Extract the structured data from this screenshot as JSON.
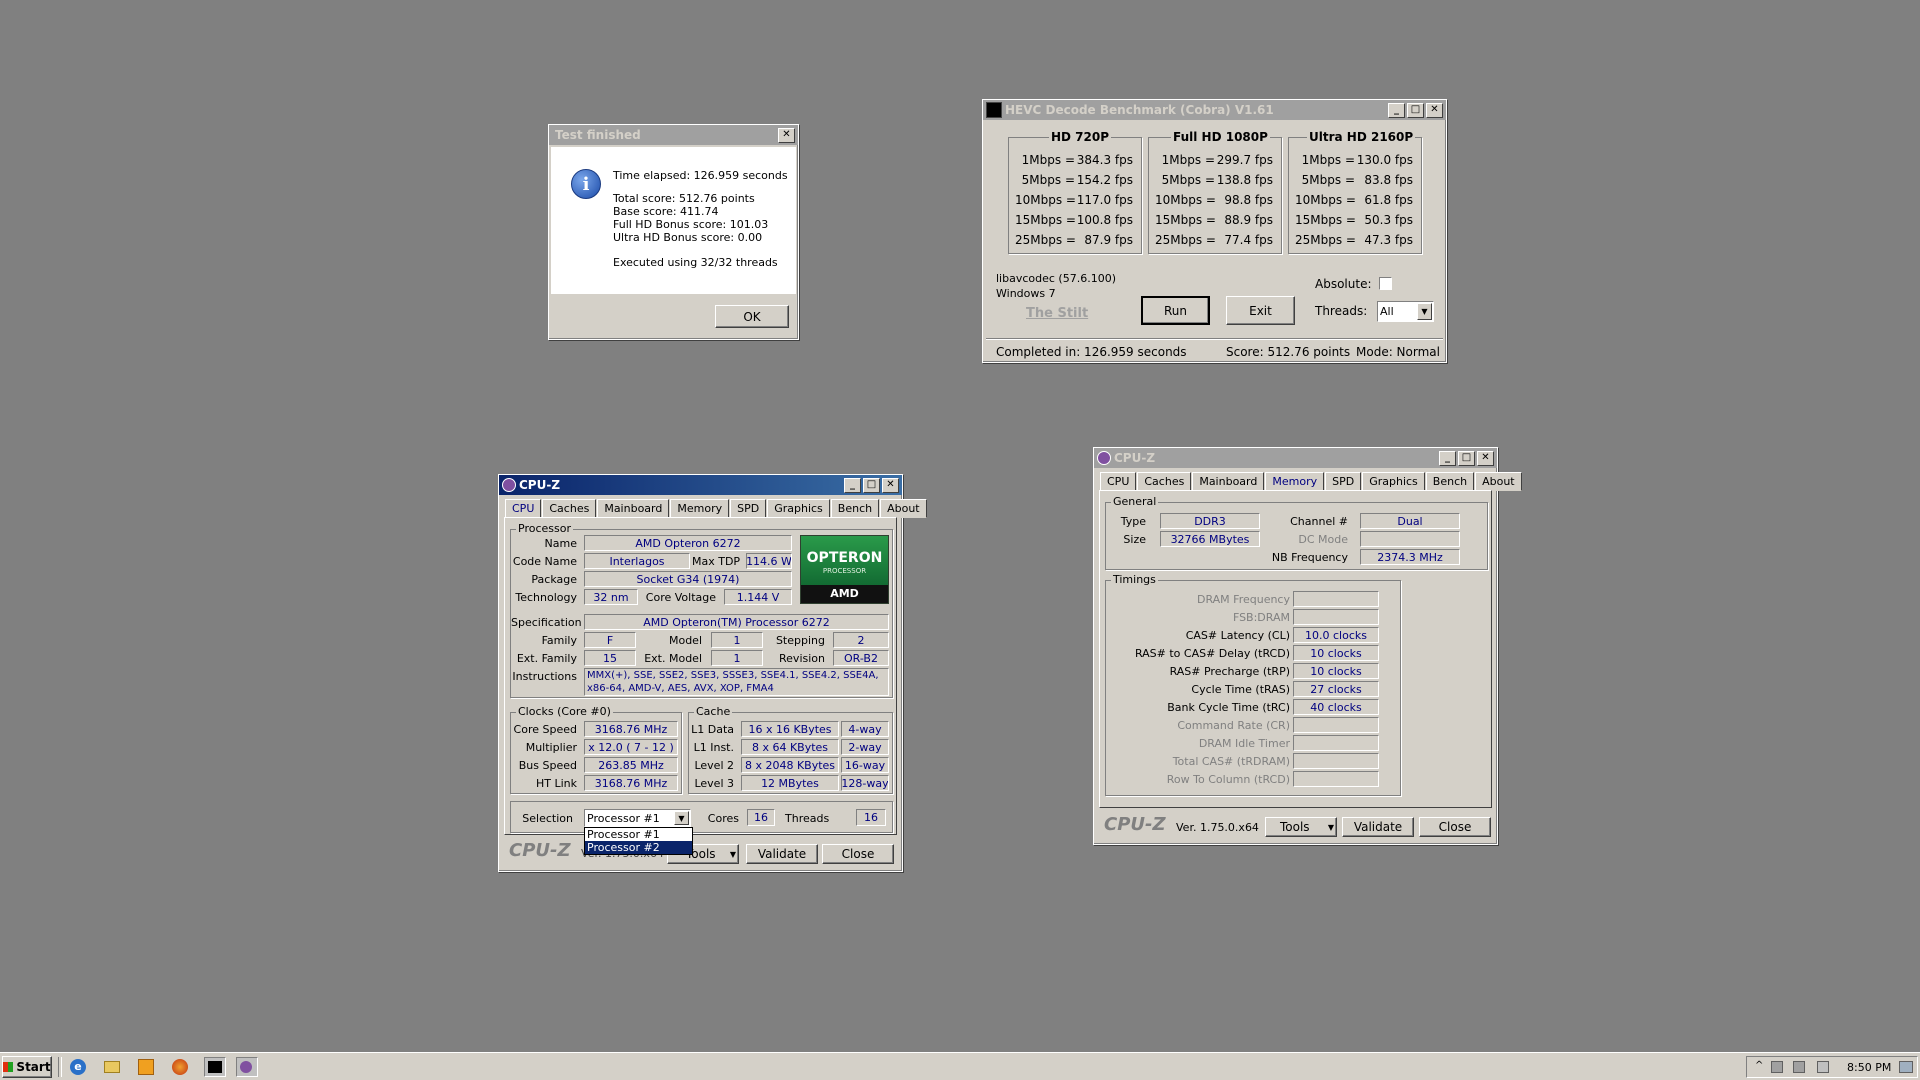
{
  "test_dialog": {
    "title": "Test finished",
    "elapsed": "Time elapsed:  126.959 seconds",
    "total": "Total score:  512.76 points",
    "base": "Base score: 411.74",
    "fullhd": "Full HD Bonus score: 101.03",
    "ultrahd": "Ultra HD Bonus score: 0.00",
    "threads": "Executed using 32/32 threads",
    "ok": "OK"
  },
  "hevc": {
    "title": "HEVC Decode Benchmark (Cobra) V1.61",
    "groups": [
      {
        "title": "HD 720P",
        "rows": [
          [
            "1Mbps =",
            "384.3 fps"
          ],
          [
            "5Mbps =",
            "154.2 fps"
          ],
          [
            "10Mbps =",
            "117.0 fps"
          ],
          [
            "15Mbps =",
            "100.8 fps"
          ],
          [
            "25Mbps =",
            "87.9 fps"
          ]
        ]
      },
      {
        "title": "Full HD 1080P",
        "rows": [
          [
            "1Mbps =",
            "299.7 fps"
          ],
          [
            "5Mbps =",
            "138.8 fps"
          ],
          [
            "10Mbps =",
            "98.8 fps"
          ],
          [
            "15Mbps =",
            "88.9 fps"
          ],
          [
            "25Mbps =",
            "77.4 fps"
          ]
        ]
      },
      {
        "title": "Ultra HD 2160P",
        "rows": [
          [
            "1Mbps =",
            "130.0 fps"
          ],
          [
            "5Mbps =",
            "83.8 fps"
          ],
          [
            "10Mbps =",
            "61.8 fps"
          ],
          [
            "15Mbps =",
            "50.3 fps"
          ],
          [
            "25Mbps =",
            "47.3 fps"
          ]
        ]
      }
    ],
    "libav": "libavcodec (57.6.100)",
    "os": "Windows 7",
    "stilt": "The Stilt",
    "run": "Run",
    "exit": "Exit",
    "absolute": "Absolute:",
    "threads_label": "Threads:",
    "threads_value": "All",
    "status_completed": "Completed in: 126.959 seconds",
    "status_score": "Score: 512.76 points",
    "status_mode": "Mode: Normal"
  },
  "cpuz_left": {
    "title": "CPU-Z",
    "tabs": [
      "CPU",
      "Caches",
      "Mainboard",
      "Memory",
      "SPD",
      "Graphics",
      "Bench",
      "About"
    ],
    "processor_group": "Processor",
    "name_label": "Name",
    "name": "AMD Opteron 6272",
    "codename_label": "Code Name",
    "codename": "Interlagos",
    "maxtdp_label": "Max TDP",
    "maxtdp": "114.6 W",
    "package_label": "Package",
    "package": "Socket G34 (1974)",
    "tech_label": "Technology",
    "tech": "32 nm",
    "voltage_label": "Core Voltage",
    "voltage": "1.144 V",
    "spec_label": "Specification",
    "spec": "AMD Opteron(TM) Processor 6272",
    "family_label": "Family",
    "family": "F",
    "model_label": "Model",
    "model": "1",
    "stepping_label": "Stepping",
    "stepping": "2",
    "extfamily_label": "Ext. Family",
    "extfamily": "15",
    "extmodel_label": "Ext. Model",
    "extmodel": "1",
    "revision_label": "Revision",
    "revision": "OR-B2",
    "instr_label": "Instructions",
    "instr1": "MMX(+), SSE, SSE2, SSE3, SSSE3, SSE4.1, SSE4.2, SSE4A,",
    "instr2": "x86-64, AMD-V, AES, AVX, XOP, FMA4",
    "logo_line1": "OPTERON",
    "logo_line2": "PROCESSOR",
    "logo_line3": "AMD",
    "clocks_group": "Clocks (Core #0)",
    "corespeed_label": "Core Speed",
    "corespeed": "3168.76 MHz",
    "multiplier_label": "Multiplier",
    "multiplier": "x 12.0 ( 7 - 12 )",
    "busspeed_label": "Bus Speed",
    "busspeed": "263.85 MHz",
    "htlink_label": "HT Link",
    "htlink": "3168.76 MHz",
    "cache_group": "Cache",
    "l1d_label": "L1 Data",
    "l1d": "16 x 16 KBytes",
    "l1d_way": "4-way",
    "l1i_label": "L1 Inst.",
    "l1i": "8 x 64 KBytes",
    "l1i_way": "2-way",
    "l2_label": "Level 2",
    "l2": "8 x 2048 KBytes",
    "l2_way": "16-way",
    "l3_label": "Level 3",
    "l3": "12 MBytes",
    "l3_way": "128-way",
    "selection_label": "Selection",
    "selection": "Processor #1",
    "cores_label": "Cores",
    "cores": "16",
    "threads_label": "Threads",
    "threads": "16",
    "dropdown_opt1": "Processor #1",
    "dropdown_opt2": "Processor #2",
    "brand": "CPU-Z",
    "version": "Ver. 1.75.0.x64",
    "tools": "Tools",
    "validate": "Validate",
    "close": "Close"
  },
  "cpuz_right": {
    "title": "CPU-Z",
    "tabs": [
      "CPU",
      "Caches",
      "Mainboard",
      "Memory",
      "SPD",
      "Graphics",
      "Bench",
      "About"
    ],
    "general_group": "General",
    "type_label": "Type",
    "type": "DDR3",
    "size_label": "Size",
    "size": "32766 MBytes",
    "channel_label": "Channel #",
    "channel": "Dual",
    "dcmode_label": "DC Mode",
    "nbfreq_label": "NB Frequency",
    "nbfreq": "2374.3 MHz",
    "timings_group": "Timings",
    "timings": [
      {
        "label": "DRAM Frequency",
        "value": "",
        "disabled": true
      },
      {
        "label": "FSB:DRAM",
        "value": "",
        "disabled": true
      },
      {
        "label": "CAS# Latency (CL)",
        "value": "10.0 clocks",
        "disabled": false
      },
      {
        "label": "RAS# to CAS# Delay (tRCD)",
        "value": "10 clocks",
        "disabled": false
      },
      {
        "label": "RAS# Precharge (tRP)",
        "value": "10 clocks",
        "disabled": false
      },
      {
        "label": "Cycle Time (tRAS)",
        "value": "27 clocks",
        "disabled": false
      },
      {
        "label": "Bank Cycle Time (tRC)",
        "value": "40 clocks",
        "disabled": false
      },
      {
        "label": "Command Rate (CR)",
        "value": "",
        "disabled": true
      },
      {
        "label": "DRAM Idle Timer",
        "value": "",
        "disabled": true
      },
      {
        "label": "Total CAS# (tRDRAM)",
        "value": "",
        "disabled": true
      },
      {
        "label": "Row To Column (tRCD)",
        "value": "",
        "disabled": true
      }
    ],
    "brand": "CPU-Z",
    "version": "Ver. 1.75.0.x64",
    "tools": "Tools",
    "validate": "Validate",
    "close": "Close"
  },
  "taskbar": {
    "start": "Start",
    "clock": "8:50 PM"
  },
  "colors": {
    "desktop": "#808080",
    "face": "#d4d0c8",
    "title_active": "#0a246a",
    "value_text": "#000080"
  }
}
